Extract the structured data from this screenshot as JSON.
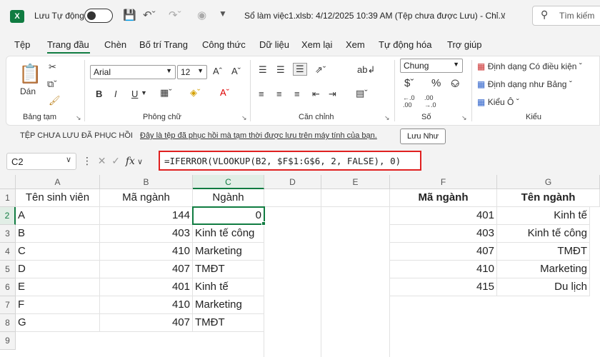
{
  "titlebar": {
    "app_icon": "X",
    "autosave_label": "Lưu Tự động",
    "doc_title": "Sổ làm việc1.xlsb: 4/12/2025 10:39 AM (Tệp chưa được Lưu)  -  Chỉ...",
    "search_label": "Tìm kiếm"
  },
  "menu": {
    "tabs": [
      "Tệp",
      "Trang đầu",
      "Chèn",
      "Bố trí Trang",
      "Công thức",
      "Dữ liệu",
      "Xem lại",
      "Xem",
      "Tự động hóa",
      "Trợ giúp"
    ]
  },
  "ribbon": {
    "paste_label": "Dán",
    "clipboard_label": "Bảng tạm",
    "font_name": "Arial",
    "font_size": "12",
    "font_group_label": "Phông chữ",
    "bold": "B",
    "italic": "I",
    "underline": "U",
    "align_label": "Căn chỉnh",
    "number_format": "Chung",
    "number_label": "Số",
    "cond_format": "Định dạng Có điều kiện",
    "table_format": "Định dạng như Bảng",
    "cell_styles": "Kiểu Ô",
    "styles_label": "Kiểu"
  },
  "notification": {
    "title": "TỆP CHƯA LƯU ĐÃ PHỤC HỒI",
    "message": "Đây là tệp đã phục hồi mà tạm thời được lưu trên máy tính của bạn.",
    "save_button": "Lưu Như"
  },
  "formula_bar": {
    "name_box": "C2",
    "fx": "fx",
    "formula": "=IFERROR(VLOOKUP(B2, $F$1:G$6, 2, FALSE), 0)"
  },
  "sheet": {
    "columns": [
      "A",
      "B",
      "C",
      "D",
      "E",
      "F",
      "G"
    ],
    "rows": [
      "1",
      "2",
      "3",
      "4",
      "5",
      "6",
      "7",
      "8",
      "9"
    ],
    "headers": {
      "A": "Tên sinh viên",
      "B": "Mã ngành",
      "C": "Ngành",
      "F": "Mã ngành",
      "G": "Tên ngành"
    },
    "students": [
      {
        "name": "A",
        "code": "144",
        "major": "0"
      },
      {
        "name": "B",
        "code": "403",
        "major": "Kinh tế công"
      },
      {
        "name": "C",
        "code": "410",
        "major": "Marketing"
      },
      {
        "name": "D",
        "code": "407",
        "major": "TMĐT"
      },
      {
        "name": "E",
        "code": "401",
        "major": "Kinh tế"
      },
      {
        "name": "F",
        "code": "410",
        "major": "Marketing"
      },
      {
        "name": "G",
        "code": "407",
        "major": "TMĐT"
      }
    ],
    "lookup": [
      {
        "code": "401",
        "name": "Kinh tế"
      },
      {
        "code": "403",
        "name": "Kinh tế công"
      },
      {
        "code": "407",
        "name": "TMĐT"
      },
      {
        "code": "410",
        "name": "Marketing"
      },
      {
        "code": "415",
        "name": "Du lịch"
      }
    ]
  }
}
